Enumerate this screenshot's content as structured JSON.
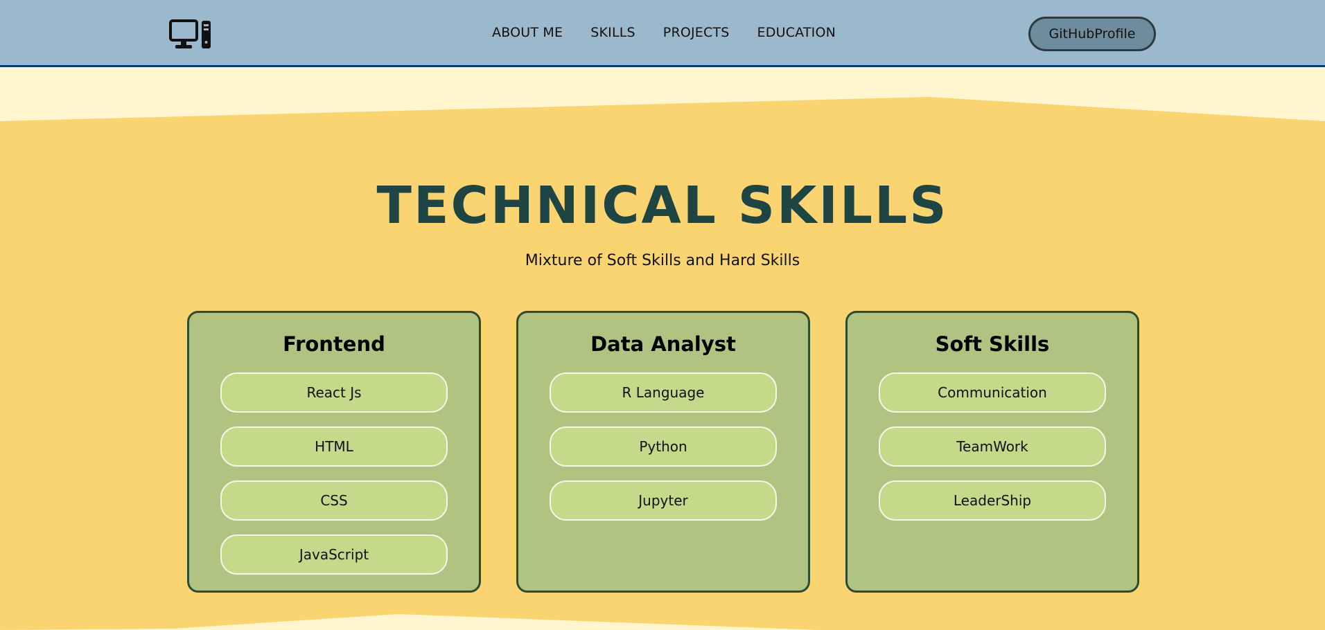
{
  "navbar": {
    "logo_icon": "desktop-computer-icon",
    "links": [
      {
        "label": "ABOUT ME"
      },
      {
        "label": "SKILLS"
      },
      {
        "label": "PROJECTS"
      },
      {
        "label": "EDUCATION"
      }
    ],
    "github_label": "GitHubProfile"
  },
  "skills": {
    "title": "TECHNICAL SKILLS",
    "subtitle": "Mixture of Soft Skills and Hard Skills",
    "cards": [
      {
        "title": "Frontend",
        "items": [
          "React Js",
          "HTML",
          "CSS",
          "JavaScript"
        ]
      },
      {
        "title": "Data Analyst",
        "items": [
          "R Language",
          "Python",
          "Jupyter"
        ]
      },
      {
        "title": "Soft Skills",
        "items": [
          "Communication",
          "TeamWork",
          "LeaderShip"
        ]
      }
    ]
  },
  "colors": {
    "navbar_bg": "#9bb8cd",
    "navbar_border": "#0b3a78",
    "page_bg": "#fad470",
    "cream": "#fff6cf",
    "title": "#1e4444",
    "card_bg": "#b0c381",
    "card_border": "#2d4a32",
    "pill_bg": "#c4d98a",
    "github_btn_bg": "#6f8c9e"
  }
}
